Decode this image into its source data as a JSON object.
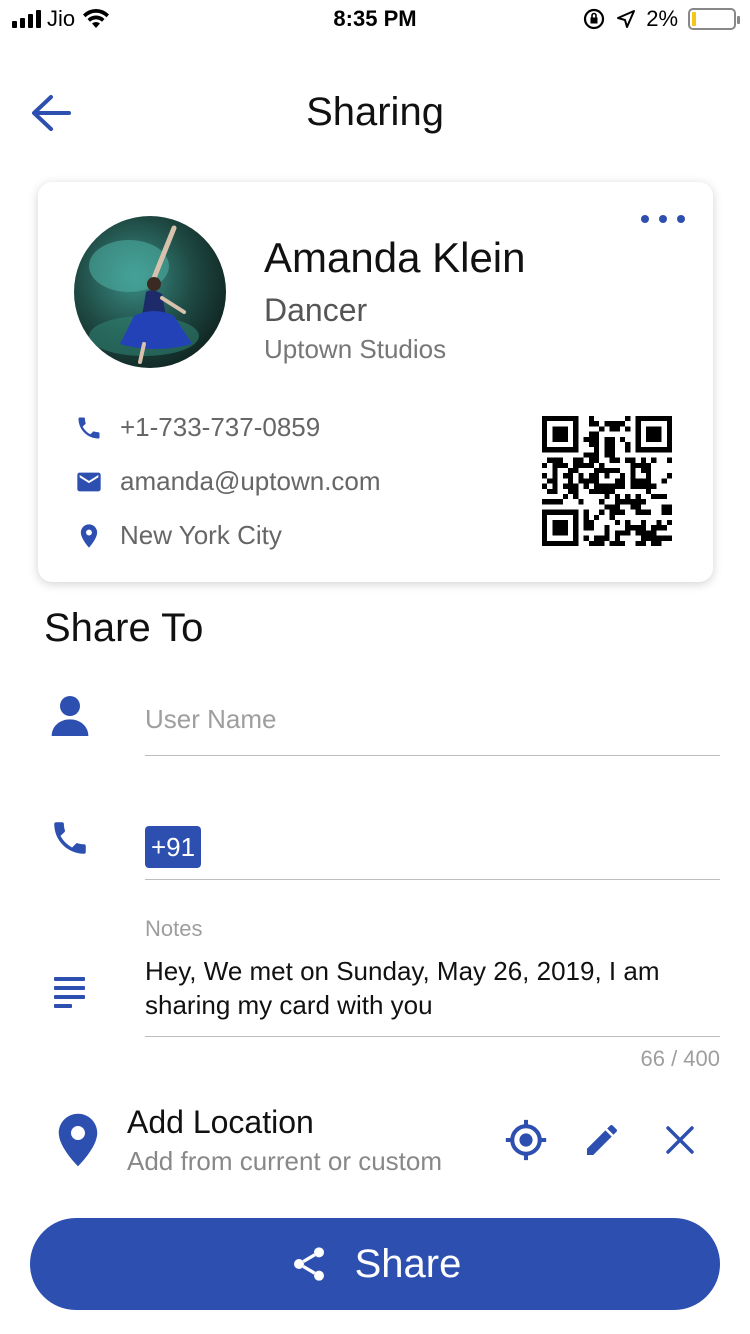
{
  "status_bar": {
    "carrier": "Jio",
    "time": "8:35 PM",
    "battery_percent": "2%"
  },
  "header": {
    "title": "Sharing",
    "back_icon": "arrow-left-icon"
  },
  "card": {
    "name": "Amanda Klein",
    "role": "Dancer",
    "company": "Uptown Studios",
    "phone": "+1-733-737-0859",
    "email": "amanda@uptown.com",
    "location": "New York City"
  },
  "share_to": {
    "title": "Share To",
    "user_name_placeholder": "User Name",
    "country_code": "+91",
    "notes_label": "Notes",
    "notes_text": "Hey, We met on Sunday, May 26, 2019, I am sharing my card with you",
    "notes_counter": "66 / 400",
    "location_title": "Add Location",
    "location_subtitle": "Add from current or custom"
  },
  "share_button": {
    "label": "Share"
  },
  "colors": {
    "accent": "#2d4fb0"
  }
}
